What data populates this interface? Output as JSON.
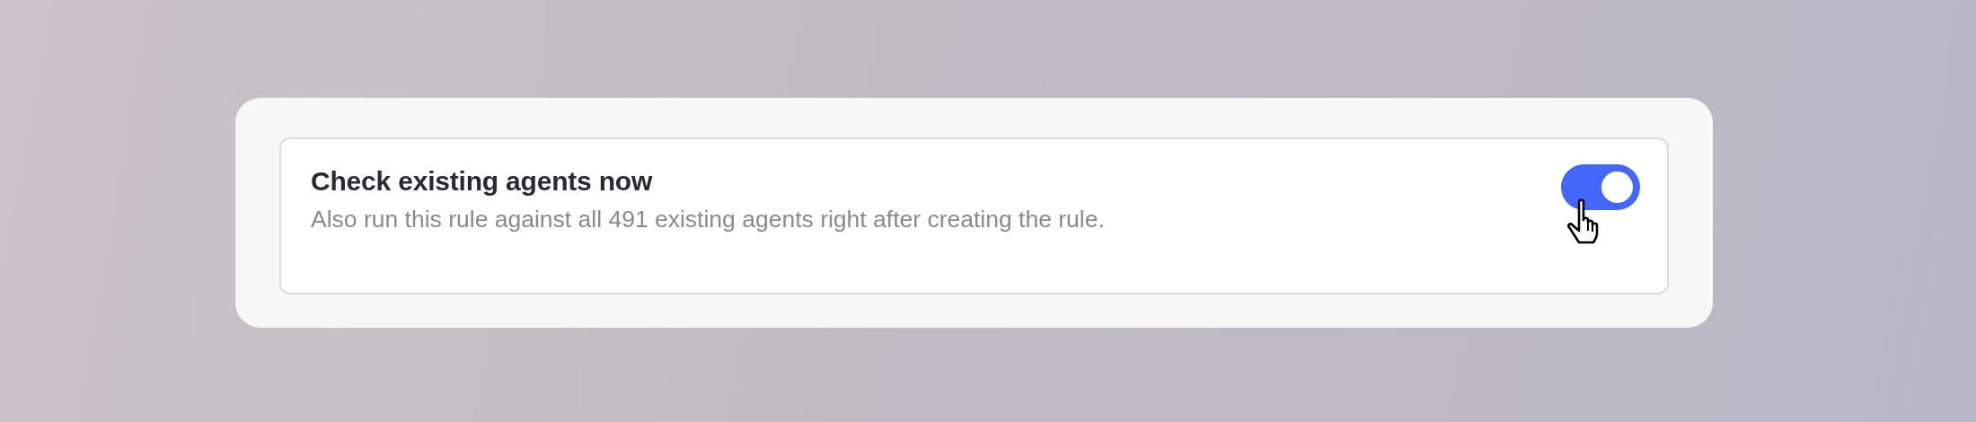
{
  "setting": {
    "title": "Check existing agents now",
    "description": "Also run this rule against all 491 existing agents right after creating the rule.",
    "on": true
  }
}
